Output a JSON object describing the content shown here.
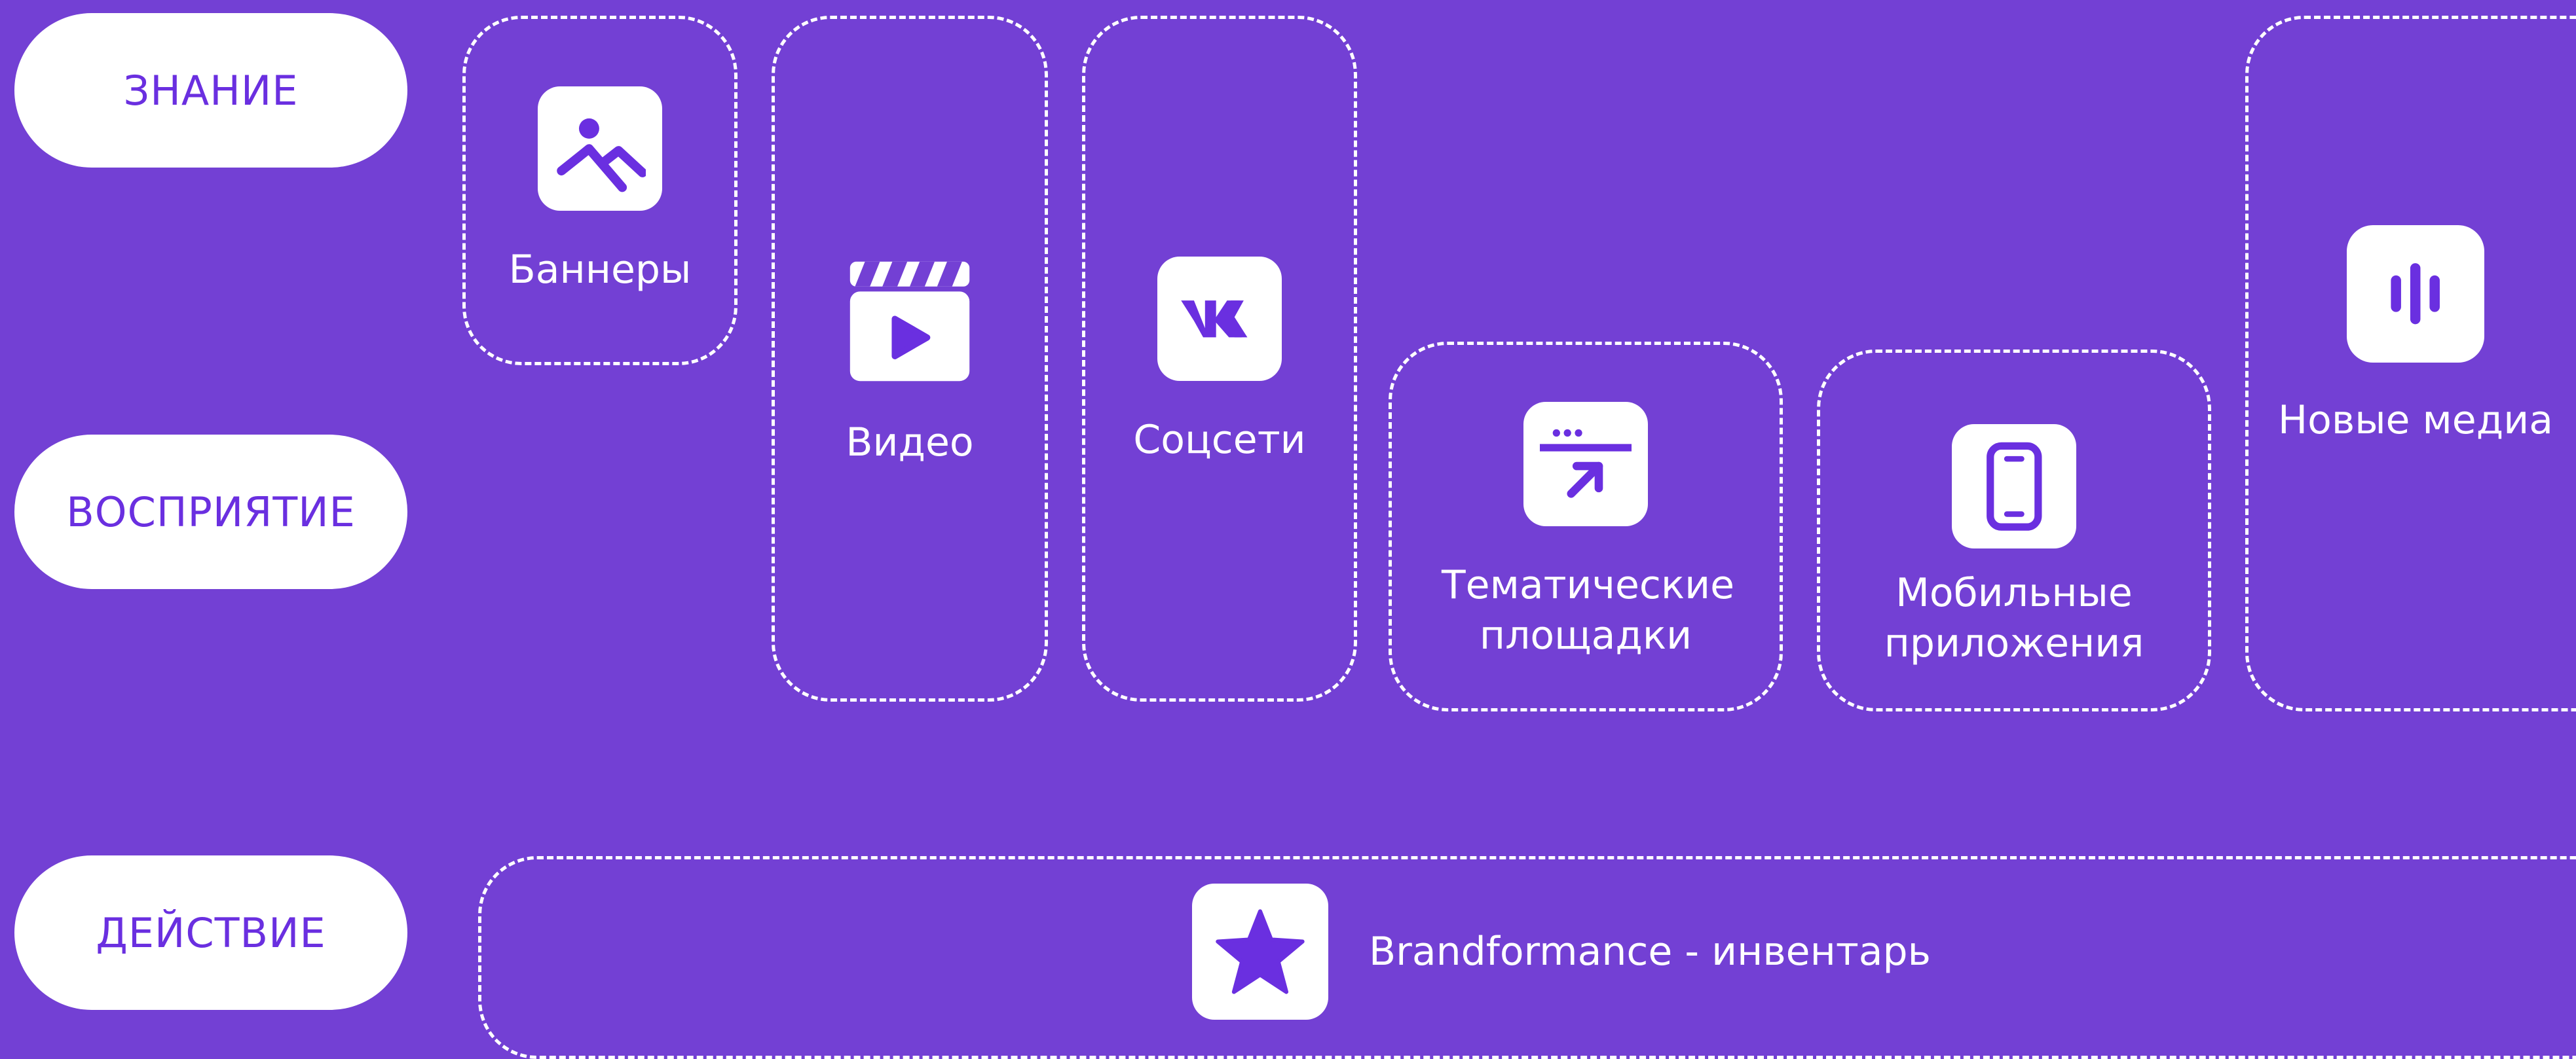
{
  "stages": {
    "awareness": "ЗНАНИЕ",
    "perception": "ВОСПРИЯТИЕ",
    "action": "ДЕЙСТВИЕ"
  },
  "channels": {
    "banners": "Баннеры",
    "video": "Видео",
    "social": "Соцсети",
    "thematic": "Тематические площадки",
    "mobile": "Мобильные приложения",
    "newmedia": "Новые медиа",
    "brandformance": "Brandformance - инвентарь"
  },
  "icons": {
    "banners": "image-icon",
    "video": "video-clapper-icon",
    "social": "vk-icon",
    "thematic": "browser-window-arrow-icon",
    "mobile": "smartphone-icon",
    "newmedia": "audio-wave-icon",
    "brandformance": "star-icon"
  },
  "colors": {
    "background": "#7340d4",
    "accent": "#6a2fe0",
    "white": "#ffffff"
  }
}
